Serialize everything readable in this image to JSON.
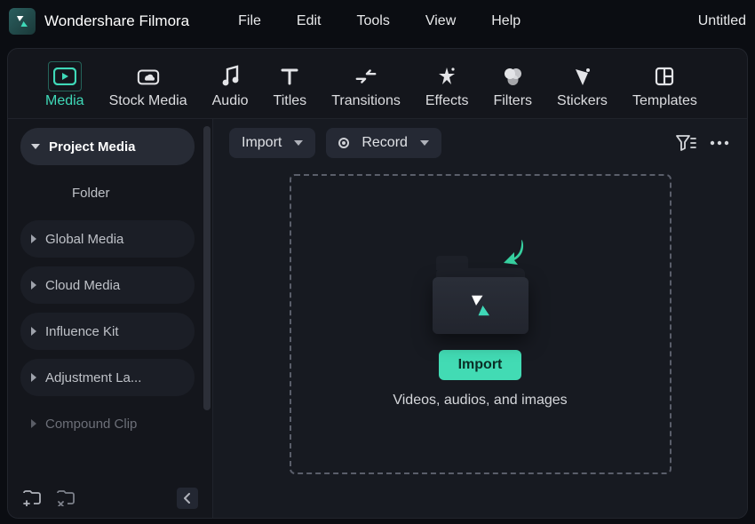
{
  "app": {
    "name": "Wondershare Filmora",
    "document_title": "Untitled"
  },
  "menubar": {
    "file": "File",
    "edit": "Edit",
    "tools": "Tools",
    "view": "View",
    "help": "Help"
  },
  "tabs": {
    "media": "Media",
    "stock_media": "Stock Media",
    "audio": "Audio",
    "titles": "Titles",
    "transitions": "Transitions",
    "effects": "Effects",
    "filters": "Filters",
    "stickers": "Stickers",
    "templates": "Templates"
  },
  "sidebar": {
    "project_media": "Project Media",
    "folder": "Folder",
    "global_media": "Global Media",
    "cloud_media": "Cloud Media",
    "influence_kit": "Influence Kit",
    "adjustment_layer": "Adjustment La...",
    "compound_clip": "Compound Clip"
  },
  "toolbar": {
    "import": "Import",
    "record": "Record"
  },
  "dropzone": {
    "import_button": "Import",
    "caption": "Videos, audios, and images"
  },
  "colors": {
    "accent": "#3fd9b8"
  }
}
